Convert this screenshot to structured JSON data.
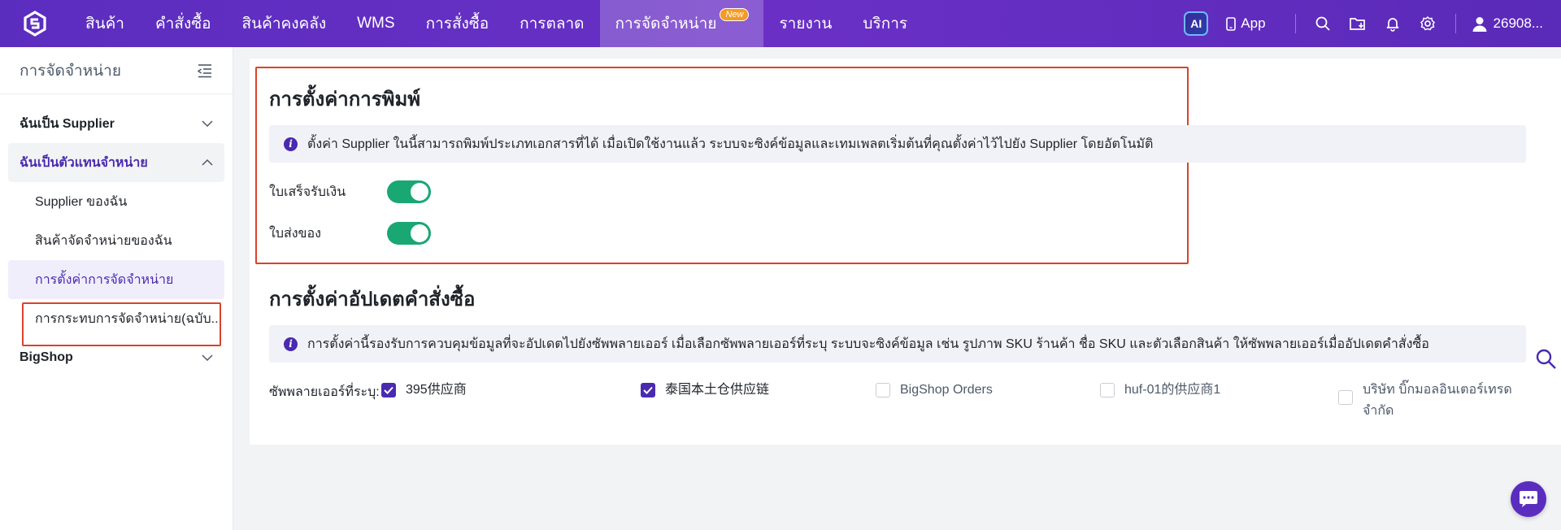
{
  "topnav": {
    "items": [
      {
        "label": "สินค้า"
      },
      {
        "label": "คำสั่งซื้อ"
      },
      {
        "label": "สินค้าคงคลัง"
      },
      {
        "label": "WMS"
      },
      {
        "label": "การสั่งซื้อ"
      },
      {
        "label": "การตลาด"
      },
      {
        "label": "การจัดจำหน่าย",
        "badge": "New",
        "active": true
      },
      {
        "label": "รายงาน"
      },
      {
        "label": "บริการ"
      }
    ],
    "ai_label": "AI",
    "app_label": "App",
    "user_label": "26908..."
  },
  "sidebar": {
    "title": "การจัดจำหน่าย",
    "groups": [
      {
        "label": "ฉันเป็น Supplier"
      },
      {
        "label": "ฉันเป็นตัวแทนจำหน่าย"
      },
      {
        "label": "BigShop"
      }
    ],
    "sub_items": [
      {
        "label": "Supplier ของฉัน"
      },
      {
        "label": "สินค้าจัดจำหน่ายของฉัน"
      },
      {
        "label": "การตั้งค่าการจัดจำหน่าย"
      },
      {
        "label": "การกระทบการจัดจำหน่าย(ฉบับ..."
      }
    ]
  },
  "print_settings": {
    "title": "การตั้งค่าการพิมพ์",
    "info": "ตั้งค่า Supplier ในนี้สามารถพิมพ์ประเภทเอกสารที่ได้ เมื่อเปิดใช้งานแล้ว ระบบจะซิงค์ข้อมูลและเทมเพลตเริ่มต้นที่คุณตั้งค่าไว้ไปยัง Supplier โดยอัตโนมัติ",
    "toggles": [
      {
        "label": "ใบเสร็จรับเงิน",
        "on": true
      },
      {
        "label": "ใบส่งของ",
        "on": true
      }
    ]
  },
  "order_update": {
    "title": "การตั้งค่าอัปเดตคำสั่งซื้อ",
    "info": "การตั้งค่านี้รองรับการควบคุมข้อมูลที่จะอัปเดตไปยังซัพพลายเออร์ เมื่อเลือกซัพพลายเออร์ที่ระบุ ระบบจะซิงค์ข้อมูล เช่น รูปภาพ SKU ร้านค้า ชื่อ SKU และตัวเลือกสินค้า ให้ซัพพลายเออร์เมื่ออัปเดตคำสั่งซื้อ",
    "supplier_label": "ซัพพลายเออร์ที่ระบุ:",
    "suppliers": [
      {
        "label": "395供应商",
        "checked": true
      },
      {
        "label": "泰国本土仓供应链",
        "checked": true
      },
      {
        "label": "BigShop Orders",
        "checked": false
      },
      {
        "label": "huf-01的供应商1",
        "checked": false
      },
      {
        "label": "บริษัท บิ๊กมอลอินเตอร์เทรด จำกัด",
        "checked": false
      }
    ]
  },
  "colors": {
    "brand": "#5b2dbf",
    "accent": "#4a2ab0",
    "switch_on": "#19a774",
    "highlight": "#d9422c"
  }
}
